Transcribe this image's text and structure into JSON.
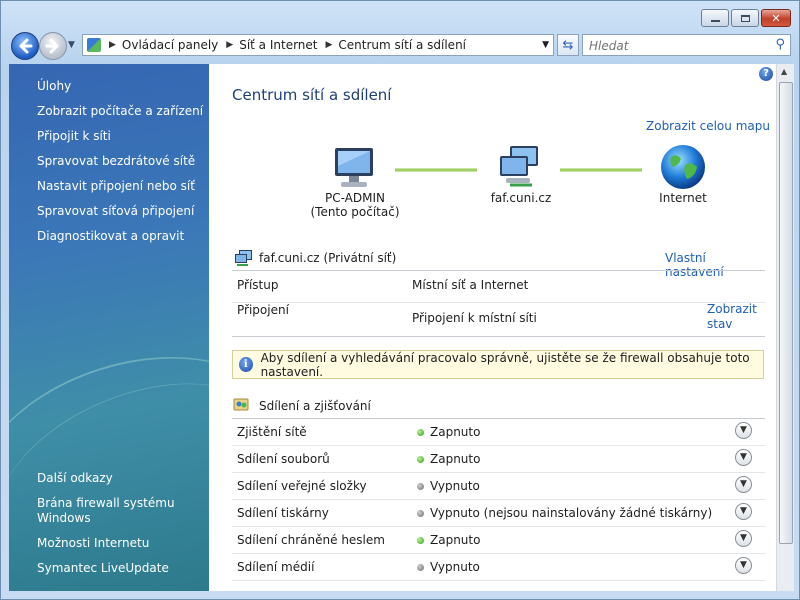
{
  "window": {
    "caption": {
      "minimize": "▭",
      "maximize": "▢",
      "close": "✕"
    }
  },
  "nav": {
    "address_crumbs": [
      "Ovládací panely",
      "Síť a Internet",
      "Centrum sítí a sdílení"
    ],
    "search_placeholder": "Hledat"
  },
  "sidebar": {
    "tasks_heading": "Úlohy",
    "tasks": [
      "Zobrazit počítače a zařízení",
      "Připojit k síti",
      "Spravovat bezdrátové sítě",
      "Nastavit připojení nebo síť",
      "Spravovat síťová připojení",
      "Diagnostikovat a opravit"
    ],
    "more_heading": "Další odkazy",
    "more_links": [
      "Brána firewall systému Windows",
      "Možnosti Internetu",
      "Symantec LiveUpdate"
    ]
  },
  "main": {
    "title": "Centrum sítí a sdílení",
    "full_map_link": "Zobrazit celou mapu",
    "map_nodes": [
      {
        "label": "PC-ADMIN",
        "sublabel": "(Tento počítač)"
      },
      {
        "label": "faf.cuni.cz",
        "sublabel": ""
      },
      {
        "label": "Internet",
        "sublabel": ""
      }
    ],
    "network": {
      "name": "faf.cuni.cz",
      "type": "(Privátní síť)",
      "customize_link": "Vlastní nastavení",
      "access_label": "Přístup",
      "access_value": "Místní síť a Internet",
      "connection_label": "Připojení",
      "connection_value": "Připojení k místní síti",
      "status_link": [
        "Zobrazit",
        "stav"
      ]
    },
    "info_message": "Aby sdílení a vyhledávání pracovalo správně, ujistěte se že firewall obsahuje toto nastavení.",
    "sharing_title": "Sdílení a zjišťování",
    "sharing": [
      {
        "label": "Zjištění sítě",
        "value": "Zapnuto",
        "on": true
      },
      {
        "label": "Sdílení souborů",
        "value": "Zapnuto",
        "on": true
      },
      {
        "label": "Sdílení veřejné složky",
        "value": "Vypnuto",
        "on": false
      },
      {
        "label": "Sdílení tiskárny",
        "value": "Vypnuto (nejsou nainstalovány žádné tiskárny)",
        "on": false
      },
      {
        "label": "Sdílení chráněné heslem",
        "value": "Zapnuto",
        "on": true
      },
      {
        "label": "Sdílení médií",
        "value": "Vypnuto",
        "on": false
      }
    ]
  },
  "colors": {
    "link": "#1f5fb2",
    "title": "#1f3f7a",
    "on": "#2d9a14",
    "off": "#6a6a6a"
  }
}
